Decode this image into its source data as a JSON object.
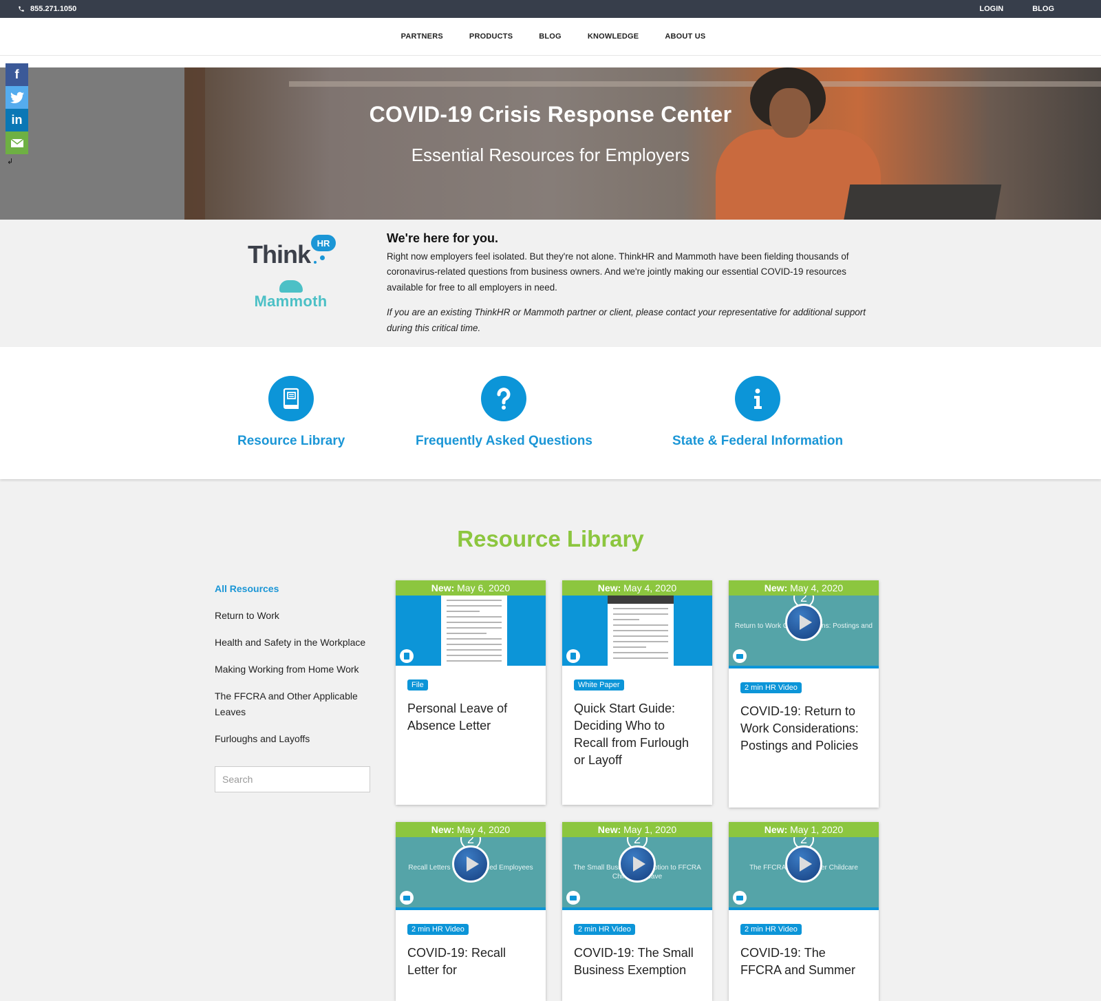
{
  "topbar": {
    "phone": "855.271.1050",
    "links": [
      "LOGIN",
      "BLOG"
    ]
  },
  "nav": {
    "items": [
      "PARTNERS",
      "PRODUCTS",
      "BLOG",
      "KNOWLEDGE",
      "ABOUT US"
    ]
  },
  "social": {
    "hide_glyph": "↲"
  },
  "hero": {
    "title": "COVID-19 Crisis Response Center",
    "subtitle": "Essential Resources for Employers"
  },
  "intro": {
    "logo_primary": "Think",
    "logo_badge": "HR",
    "logo_secondary": "Mammoth",
    "heading": "We're here for you.",
    "body": "Right now employers feel isolated. But they're not alone. ThinkHR and Mammoth have been fielding thousands of coronavirus-related questions from business owners. And we're jointly making our essential COVID-19 resources available for free to all employers in need.",
    "note": "If you are an existing ThinkHR or Mammoth partner or client, please contact your representative for additional support during this critical time."
  },
  "quicklinks": [
    {
      "label": "Resource Library",
      "icon": "book-icon"
    },
    {
      "label": "Frequently Asked Questions",
      "icon": "question-icon"
    },
    {
      "label": "State & Federal Information",
      "icon": "info-icon"
    }
  ],
  "library": {
    "title": "Resource Library",
    "categories": [
      "All Resources",
      "Return to Work",
      "Health and Safety in the Workplace",
      "Making Working from Home Work",
      "The FFCRA and Other Applicable Leaves",
      "Furloughs and Layoffs"
    ],
    "active_category": "All Resources",
    "search_placeholder": "Search",
    "new_prefix": "New:",
    "cards": [
      {
        "date": "May 6, 2020",
        "tag": "File",
        "title": "Personal Leave of Absence Letter",
        "thumb": "document"
      },
      {
        "date": "May 4, 2020",
        "tag": "White Paper",
        "title": "Quick Start Guide: Deciding Who to Recall from Furlough or Layoff",
        "thumb": "document"
      },
      {
        "date": "May 4, 2020",
        "tag": "2 min HR Video",
        "title": "COVID-19: Return to Work Considerations: Postings and Policies",
        "thumb": "video",
        "video_caption": "Return to Work Considerations: Postings and Policies",
        "video_number": "2"
      },
      {
        "date": "May 4, 2020",
        "tag": "2 min HR Video",
        "title": "COVID-19: Recall Letter for",
        "thumb": "video",
        "video_caption": "Recall Letters for Furloughed Employees",
        "video_number": "2"
      },
      {
        "date": "May 1, 2020",
        "tag": "2 min HR Video",
        "title": "COVID-19: The Small Business Exemption",
        "thumb": "video",
        "video_caption": "The Small Business Exemption to FFCRA Childcare Leave",
        "video_number": "2"
      },
      {
        "date": "May 1, 2020",
        "tag": "2 min HR Video",
        "title": "COVID-19: The FFCRA and Summer",
        "thumb": "video",
        "video_caption": "The FFCRA and Summer Childcare",
        "video_number": "2"
      }
    ]
  },
  "colors": {
    "topbar": "#373e4b",
    "brand_blue": "#0c95d8",
    "brand_green": "#8cc63f",
    "teal": "#4cc0c6"
  }
}
